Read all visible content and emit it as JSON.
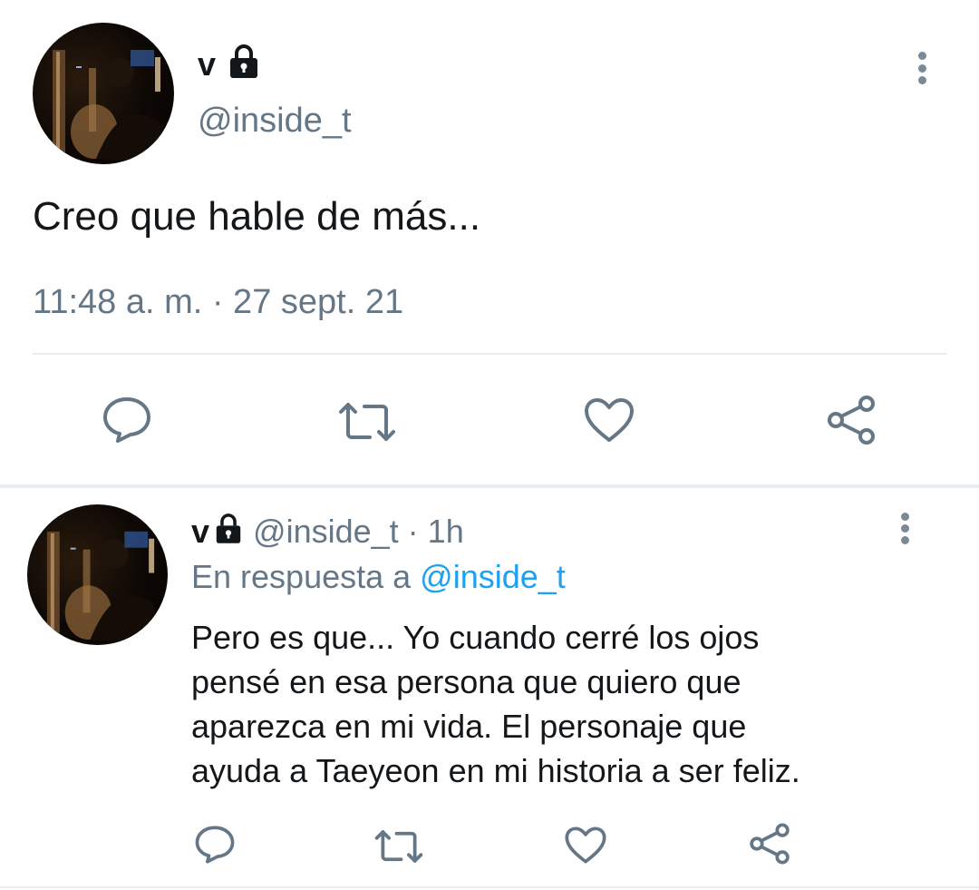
{
  "main_tweet": {
    "display_name": "v",
    "handle": "@inside_t",
    "text": "Creo que hable de más...",
    "timestamp": "11:48 a. m. · 27 sept. 21",
    "avatar_icon": "avatar-photo",
    "locked_icon": "lock-icon",
    "actions": [
      "reply-icon",
      "retweet-icon",
      "like-icon",
      "share-icon"
    ]
  },
  "reply_tweet": {
    "display_name": "v",
    "handle": "@inside_t",
    "dot": "·",
    "time_ago": "1h",
    "replying_prefix": "En respuesta a",
    "replying_mention": "@inside_t",
    "text_lines": [
      "Pero es que... Yo cuando cerré los ojos",
      "pensé en esa persona que quiero que",
      "aparezca en mi vida. El personaje que",
      "ayuda a Taeyeon en mi historia a ser feliz."
    ],
    "actions": [
      "reply-icon",
      "retweet-icon",
      "like-icon",
      "share-icon"
    ]
  },
  "colors": {
    "text": "#14171a",
    "secondary": "#657786",
    "link": "#1da1f2",
    "divider": "#e6ecf0"
  }
}
